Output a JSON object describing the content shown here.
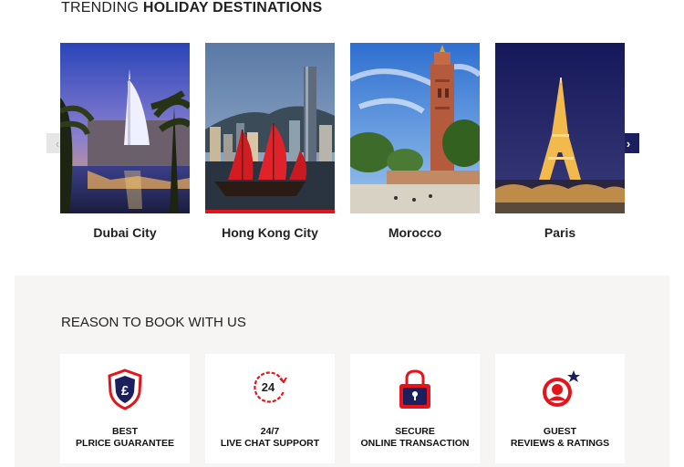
{
  "trending": {
    "heading_light": "TRENDING ",
    "heading_bold": "HOLIDAY DESTINATIONS",
    "prev_arrow": "‹",
    "next_arrow": "›",
    "destinations": [
      {
        "name": "Dubai City"
      },
      {
        "name": "Hong Kong City"
      },
      {
        "name": "Morocco"
      },
      {
        "name": "Paris"
      }
    ]
  },
  "reasons": {
    "title_light": "REASON TO ",
    "title_main": "BOOK WITH US",
    "items": [
      {
        "line1": "BEST",
        "line2": "PLRICE GUARANTEE",
        "icon": "pound-shield-icon"
      },
      {
        "line1": "24/7",
        "line2": "LIVE CHAT SUPPORT",
        "icon": "24-hour-support-icon"
      },
      {
        "line1": "SECURE",
        "line2": "ONLINE TRANSACTION",
        "icon": "padlock-icon"
      },
      {
        "line1": "GUEST",
        "line2": "REVIEWS & RATINGS",
        "icon": "guest-rating-icon"
      }
    ],
    "icon_text_24": "24",
    "icon_text_pound": "£"
  },
  "colors": {
    "accent_red": "#e4141a",
    "navy": "#1c1f5e",
    "section_bg": "#f6f5f4"
  }
}
